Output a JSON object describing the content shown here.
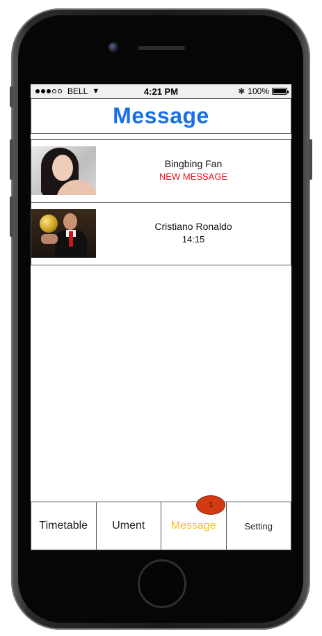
{
  "status_bar": {
    "carrier": "BELL",
    "time": "4:21 PM",
    "battery": "100%"
  },
  "header": {
    "title": "Message"
  },
  "messages": [
    {
      "name": "Bingbing Fan",
      "subtitle": "NEW MESSAGE",
      "avatar": "female-portrait-avatar"
    },
    {
      "name": "Cristiano Ronaldo",
      "subtitle": "14:15",
      "avatar": "footballer-portrait-avatar"
    }
  ],
  "tabs": [
    {
      "label": "Timetable"
    },
    {
      "label": "Ument"
    },
    {
      "label": "Message",
      "badge": "1"
    },
    {
      "label": "Setting"
    }
  ],
  "colors": {
    "title": "#1a6fe8",
    "new_message": "#e8131a",
    "active_tab": "#f5c518",
    "badge": "#d23a12"
  }
}
